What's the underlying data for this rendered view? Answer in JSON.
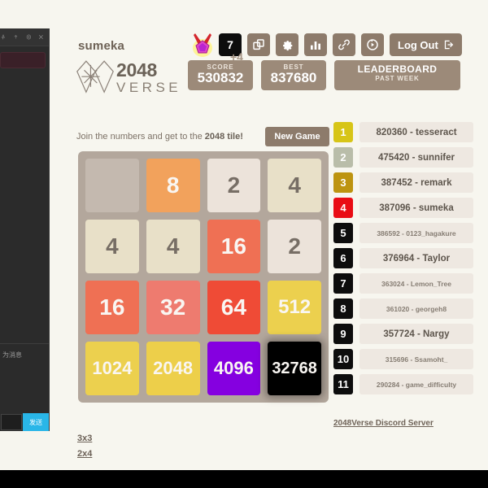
{
  "left_panel": {
    "icons": [
      "pin-icon",
      "upload-icon",
      "settings-hex-icon",
      "close-icon"
    ],
    "hint_text": "为消息",
    "send_label": "发送",
    "input_value": ""
  },
  "header": {
    "username": "sumeka",
    "logo_line1": "2048",
    "logo_line2": "VERSE",
    "tagline_prefix": "Join the numbers and get to the ",
    "tagline_bold": "2048 tile!",
    "new_game_label": "New Game"
  },
  "badges": {
    "medal_icon": "medal-icon",
    "count": "7",
    "tools": [
      {
        "name": "copy-icon",
        "label": "Copy"
      },
      {
        "name": "gear-icon",
        "label": "Settings"
      },
      {
        "name": "bar-chart-icon",
        "label": "Stats"
      },
      {
        "name": "link-icon",
        "label": "Share link"
      },
      {
        "name": "undo-icon",
        "label": "Undo"
      }
    ],
    "logout_label": "Log Out",
    "logout_icon": "exit-icon"
  },
  "scores": {
    "score_label": "SCORE",
    "score_value": "530832",
    "score_addition": "+4",
    "best_label": "BEST",
    "best_value": "837680",
    "leaderboard_title": "LEADERBOARD",
    "leaderboard_subtitle": "PAST WEEK"
  },
  "board": {
    "rows": [
      [
        0,
        8,
        2,
        4
      ],
      [
        4,
        4,
        16,
        2
      ],
      [
        16,
        32,
        64,
        512
      ],
      [
        1024,
        2048,
        4096,
        32768
      ]
    ]
  },
  "leaderboard": {
    "entries": [
      {
        "rank": "1",
        "text": "820360 - tesseract",
        "rank_color": "#d7c517",
        "small": false
      },
      {
        "rank": "2",
        "text": "475420 - sunnifer",
        "rank_color": "#b9bda9",
        "small": false
      },
      {
        "rank": "3",
        "text": "387452 - remark",
        "rank_color": "#bd9410",
        "small": false
      },
      {
        "rank": "4",
        "text": "387096 - sumeka",
        "rank_color": "#e90d15",
        "small": false
      },
      {
        "rank": "5",
        "text": "386592 - 0123_hagakure",
        "rank_color": "#0d0d0d",
        "small": true
      },
      {
        "rank": "6",
        "text": "376964 - Taylor",
        "rank_color": "#0d0d0d",
        "small": false
      },
      {
        "rank": "7",
        "text": "363024 - Lemon_Tree",
        "rank_color": "#0d0d0d",
        "small": true
      },
      {
        "rank": "8",
        "text": "361020 - georgeh8",
        "rank_color": "#0d0d0d",
        "small": true
      },
      {
        "rank": "9",
        "text": "357724 - Nargy",
        "rank_color": "#0d0d0d",
        "small": false
      },
      {
        "rank": "10",
        "text": "315696 - Ssamoht_",
        "rank_color": "#0d0d0d",
        "small": true
      },
      {
        "rank": "11",
        "text": "290284 - game_difficulty",
        "rank_color": "#0d0d0d",
        "small": true
      }
    ]
  },
  "footer": {
    "discord_link": "2048Verse Discord Server",
    "size_links": [
      "3x3",
      "2x4"
    ]
  },
  "tile_colors": {
    "0": "#c4b9af",
    "2": "#ece3da",
    "4": "#e8e0c8",
    "8": "#f2a25c",
    "16": "#ef7054",
    "32": "#ee7b6f",
    "64": "#ef4b36",
    "512": "#ecd04e",
    "1024": "#ecd04e",
    "2048": "#edcf4a",
    "4096": "#8500e0",
    "32768": "#000000"
  },
  "theme": {
    "page_bg": "#f7f6ef",
    "grid_bg": "#b3a79c",
    "accent_brown": "#8d7b6b",
    "score_bg": "#9c8a79"
  }
}
